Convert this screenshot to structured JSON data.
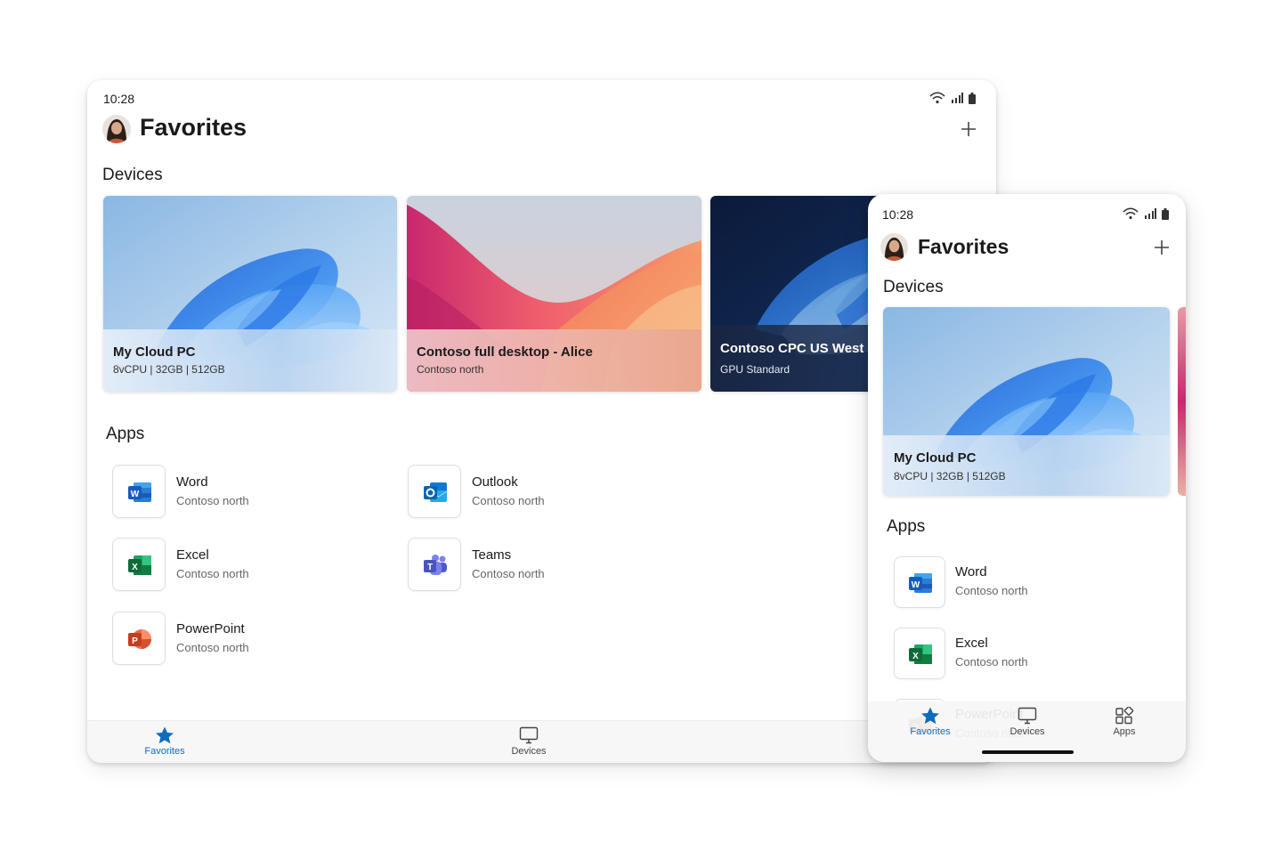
{
  "status": {
    "time": "10:28"
  },
  "header": {
    "title": "Favorites"
  },
  "sections": {
    "devices": "Devices",
    "apps": "Apps"
  },
  "devices": [
    {
      "name": "My Cloud PC",
      "spec": "8vCPU | 32GB | 512GB"
    },
    {
      "name": "Contoso full desktop - Alice",
      "spec": "Contoso north"
    },
    {
      "name": "Contoso CPC US West -",
      "spec": "GPU Standard"
    }
  ],
  "apps": [
    {
      "name": "Word",
      "location": "Contoso north",
      "icon": "word-icon"
    },
    {
      "name": "Outlook",
      "location": "Contoso north",
      "icon": "outlook-icon"
    },
    {
      "name": "Excel",
      "location": "Contoso north",
      "icon": "excel-icon"
    },
    {
      "name": "Teams",
      "location": "Contoso north",
      "icon": "teams-icon"
    },
    {
      "name": "PowerPoint",
      "location": "Contoso north",
      "icon": "powerpoint-icon"
    }
  ],
  "nav": {
    "favorites": "Favorites",
    "devices": "Devices",
    "apps": "Apps"
  },
  "colors": {
    "accent": "#0f6cbd"
  }
}
